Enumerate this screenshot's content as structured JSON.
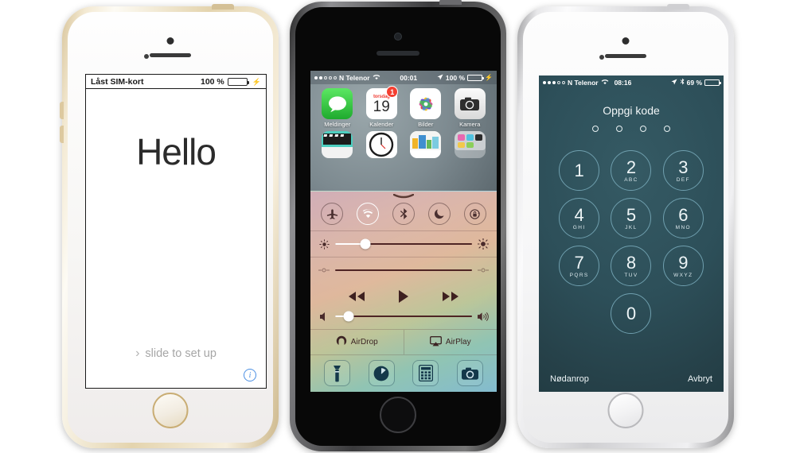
{
  "scene": {
    "description": "Three iPhone 5s devices side by side showing iOS 7 screens in Norwegian"
  },
  "phone_left": {
    "name": "iPhone 5s Gold",
    "body_color": "#e4d4ae",
    "status": {
      "title": "Låst SIM-kort",
      "battery_percent": "100 %",
      "battery_fill": 100,
      "charging_icon": "lightning-bolt-icon",
      "battery_color": "#3ddb4f"
    },
    "screen": {
      "greeting": "Hello",
      "slide_chevron": "›",
      "slide_label": "slide to set up",
      "info_label": "i",
      "info_color": "#4b8fe3"
    }
  },
  "phone_center": {
    "name": "iPhone 5s Space Gray",
    "body_color": "#3a3a3c",
    "status": {
      "signal_dots": [
        true,
        true,
        false,
        false,
        false
      ],
      "carrier": "N Telenor",
      "wifi_icon": "wifi-icon",
      "time": "00:01",
      "location_icon": "location-arrow-icon",
      "battery_percent": "100 %",
      "battery_fill": 100,
      "charging_icon": "lightning-bolt-icon"
    },
    "home_apps": [
      {
        "label": "Meldinger",
        "icon": "messages-icon",
        "badge": ""
      },
      {
        "label": "Kalender",
        "icon": "calendar-icon",
        "badge": "1",
        "cal_weekday": "torsdag",
        "cal_day": "19"
      },
      {
        "label": "Bilder",
        "icon": "photos-icon",
        "badge": ""
      },
      {
        "label": "Kamera",
        "icon": "camera-icon",
        "badge": ""
      }
    ],
    "home_apps_row2": [
      {
        "icon": "videos-icon"
      },
      {
        "icon": "clock-icon"
      },
      {
        "icon": "newsstand-icon"
      },
      {
        "icon": "folder-icon"
      }
    ],
    "control_center": {
      "grabber": "chevron-up-grabber-icon",
      "toggles": [
        {
          "name": "airplane-mode",
          "icon": "airplane-icon",
          "active": false
        },
        {
          "name": "wifi",
          "icon": "wifi-icon",
          "active": true
        },
        {
          "name": "bluetooth",
          "icon": "bluetooth-icon",
          "active": false
        },
        {
          "name": "do-not-disturb",
          "icon": "moon-icon",
          "active": false
        },
        {
          "name": "rotation-lock",
          "icon": "rotation-lock-icon",
          "active": false
        }
      ],
      "brightness": {
        "icon_left": "brightness-low-icon",
        "icon_right": "brightness-high-icon",
        "value": 22
      },
      "airplay_slider": {
        "icon_left": "airplay-scrub-icon",
        "icon_right": "airplay-scrub-icon",
        "value": 0
      },
      "media": [
        {
          "name": "rewind-button",
          "icon": "rewind-icon"
        },
        {
          "name": "play-button",
          "icon": "play-icon"
        },
        {
          "name": "forward-button",
          "icon": "fast-forward-icon"
        }
      ],
      "volume": {
        "icon_left": "volume-low-icon",
        "icon_right": "volume-high-icon",
        "value": 10
      },
      "sharing": [
        {
          "label": "AirDrop",
          "icon": "airdrop-icon"
        },
        {
          "label": "AirPlay",
          "icon": "airplay-icon"
        }
      ],
      "shortcuts": [
        {
          "name": "flashlight",
          "icon": "flashlight-icon"
        },
        {
          "name": "timer",
          "icon": "timer-icon"
        },
        {
          "name": "calculator",
          "icon": "calculator-icon"
        },
        {
          "name": "camera",
          "icon": "camera-icon"
        }
      ]
    }
  },
  "phone_right": {
    "name": "iPhone 5s Silver",
    "body_color": "#cfcfd2",
    "status": {
      "signal_dots": [
        true,
        true,
        true,
        false,
        false
      ],
      "carrier": "N Telenor",
      "wifi_icon": "wifi-icon",
      "time": "08:16",
      "location_icon": "location-arrow-icon",
      "bluetooth_icon": "bluetooth-icon",
      "battery_percent": "69 %",
      "battery_fill": 69
    },
    "passcode": {
      "title": "Oppgi kode",
      "entered_digits": 0,
      "pip_count": 4,
      "keys": [
        {
          "num": "1",
          "letters": ""
        },
        {
          "num": "2",
          "letters": "ABC"
        },
        {
          "num": "3",
          "letters": "DEF"
        },
        {
          "num": "4",
          "letters": "GHI"
        },
        {
          "num": "5",
          "letters": "JKL"
        },
        {
          "num": "6",
          "letters": "MNO"
        },
        {
          "num": "7",
          "letters": "PQRS"
        },
        {
          "num": "8",
          "letters": "TUV"
        },
        {
          "num": "9",
          "letters": "WXYZ"
        },
        {
          "num": "0",
          "letters": ""
        }
      ],
      "emergency_label": "Nødanrop",
      "cancel_label": "Avbryt"
    }
  }
}
